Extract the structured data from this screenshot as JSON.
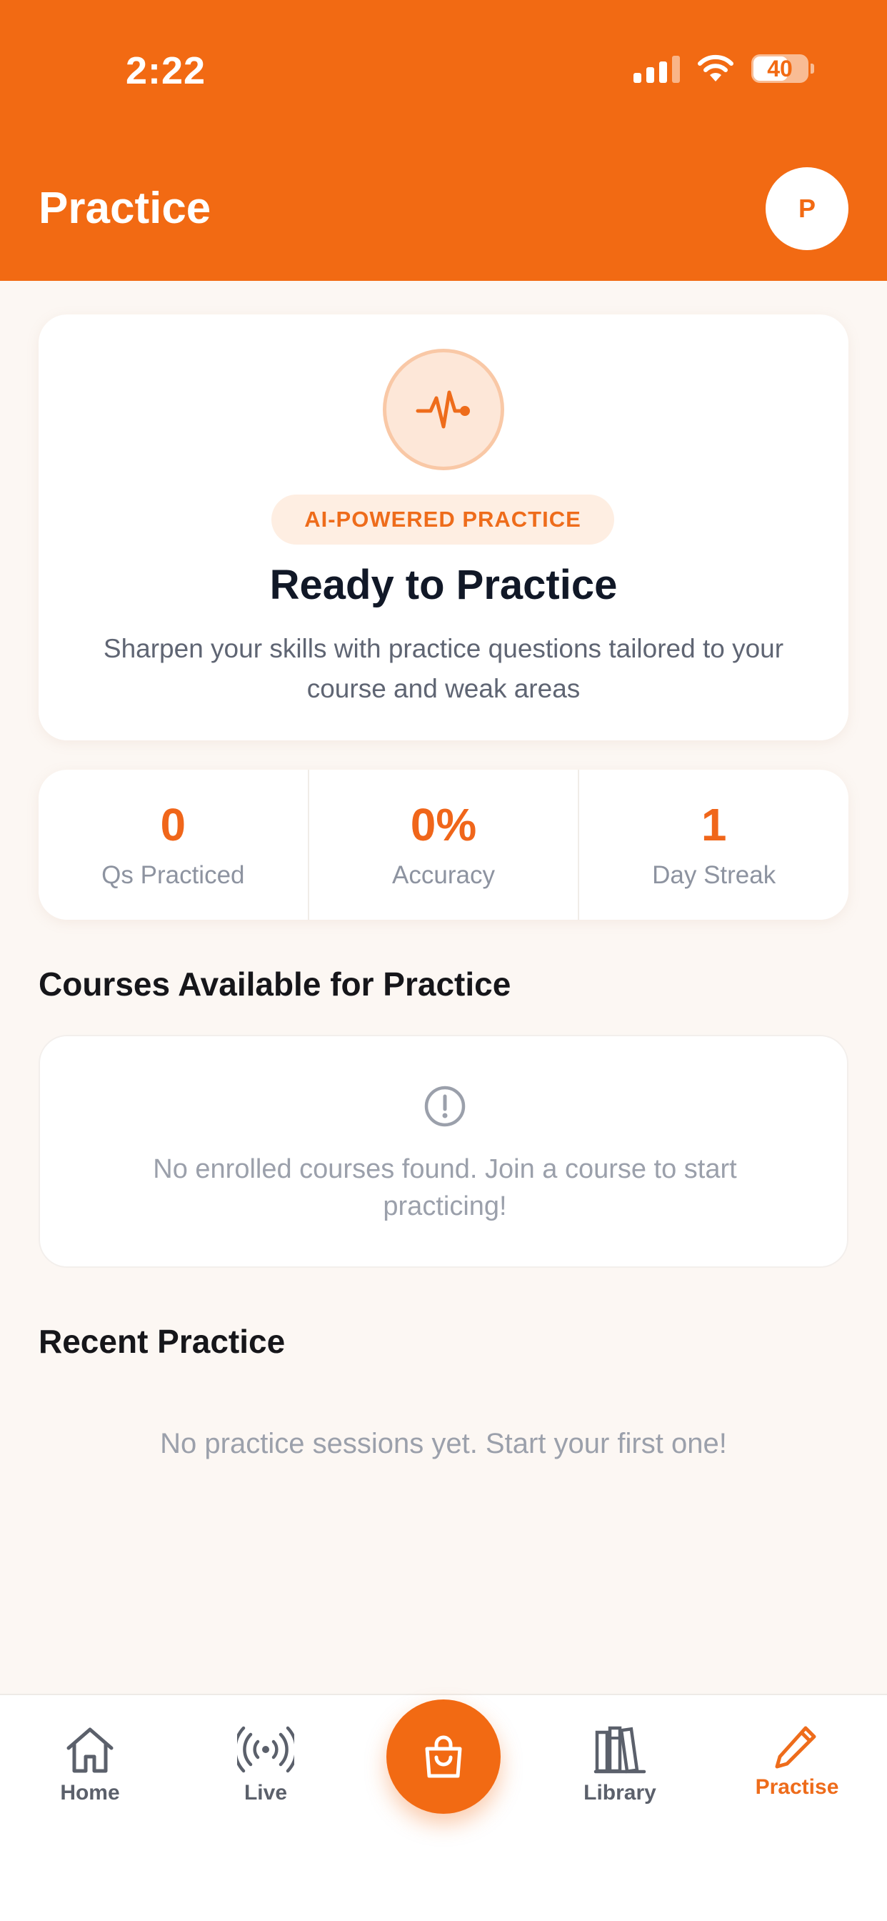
{
  "status_bar": {
    "time": "2:22",
    "battery": "40"
  },
  "header": {
    "title": "Practice",
    "avatar_initial": "P"
  },
  "hero": {
    "badge": "AI-POWERED PRACTICE",
    "title": "Ready to Practice",
    "subtitle": "Sharpen your skills with practice questions tailored to your course and weak areas",
    "icon": "pulse-icon"
  },
  "stats": [
    {
      "value": "0",
      "label": "Qs Practiced"
    },
    {
      "value": "0%",
      "label": "Accuracy"
    },
    {
      "value": "1",
      "label": "Day Streak"
    }
  ],
  "courses": {
    "title": "Courses Available for Practice",
    "empty_message": "No enrolled courses found. Join a course to start practicing!",
    "icon": "alert-circle-icon"
  },
  "recent": {
    "title": "Recent Practice",
    "empty_message": "No practice sessions yet. Start your first one!"
  },
  "nav": {
    "items": [
      {
        "label": "Home",
        "icon": "home-icon"
      },
      {
        "label": "Live",
        "icon": "broadcast-icon"
      },
      {
        "label": "",
        "icon": "shopping-bag-icon"
      },
      {
        "label": "Library",
        "icon": "library-icon"
      },
      {
        "label": "Practise",
        "icon": "pencil-icon",
        "active": true
      }
    ]
  },
  "colors": {
    "accent": "#f26a13",
    "background": "#fcf7f3",
    "muted_text": "#9ba0ab"
  }
}
